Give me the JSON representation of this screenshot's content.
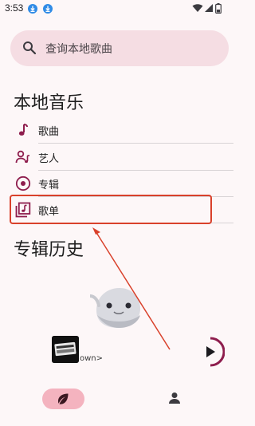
{
  "status_bar": {
    "time": "3:53",
    "icons": [
      "download-icon",
      "download-icon",
      "wifi-icon",
      "cell-signal-icon",
      "battery-icon"
    ]
  },
  "search": {
    "placeholder": "查询本地歌曲",
    "icon": "search-icon"
  },
  "local_music": {
    "title": "本地音乐",
    "items": [
      {
        "label": "歌曲",
        "icon": "music-note-icon"
      },
      {
        "label": "艺人",
        "icon": "artist-icon"
      },
      {
        "label": "专辑",
        "icon": "album-icon"
      },
      {
        "label": "歌单",
        "icon": "playlist-icon"
      }
    ]
  },
  "album_history": {
    "title": "专辑历史"
  },
  "mini_player": {
    "track_text": "own>",
    "icons": [
      "album-thumbnail",
      "play-icon"
    ]
  },
  "bottom_nav": {
    "items": [
      {
        "icon": "leaf-icon",
        "active": true
      },
      {
        "icon": "person-icon",
        "active": false
      }
    ]
  },
  "colors": {
    "background": "#fdf7f8",
    "search_bg": "#f5dde3",
    "accent": "#8e1d4d",
    "annotation": "#d9412b",
    "nav_active": "#f4b3bf"
  }
}
